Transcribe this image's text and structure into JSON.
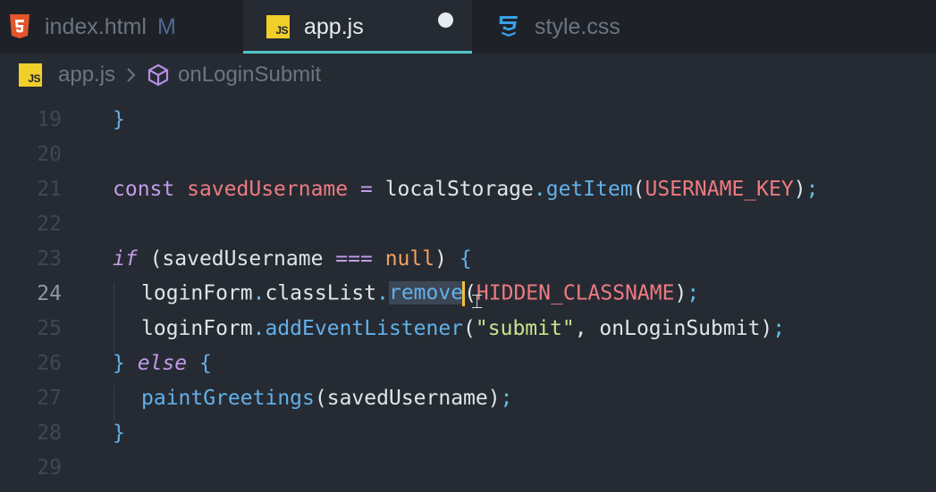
{
  "tabs": [
    {
      "label": "index.html",
      "modifier": "M",
      "icon": "html5-icon",
      "active": false
    },
    {
      "label": "app.js",
      "modifier": "",
      "icon": "js-icon",
      "active": true,
      "unsaved": true
    },
    {
      "label": "style.css",
      "modifier": "",
      "icon": "css3-icon",
      "active": false
    }
  ],
  "js_badge_text": "JS",
  "breadcrumb": {
    "file": "app.js",
    "separator_icon": "chevron-right-icon",
    "symbol_icon": "method-cube-icon",
    "symbol": "onLoginSubmit"
  },
  "editor": {
    "active_line": 24,
    "lines": [
      {
        "num": "19"
      },
      {
        "num": "20"
      },
      {
        "num": "21"
      },
      {
        "num": "22"
      },
      {
        "num": "23"
      },
      {
        "num": "24"
      },
      {
        "num": "25"
      },
      {
        "num": "26"
      },
      {
        "num": "27"
      },
      {
        "num": "28"
      },
      {
        "num": "29"
      }
    ],
    "tokens": {
      "l19_brace": "}",
      "const": "const",
      "savedUsername": "savedUsername",
      "eq": "=",
      "localStorage": "localStorage",
      "getItem": "getItem",
      "USERNAME_KEY": "USERNAME_KEY",
      "if": "if",
      "strict_eq": "===",
      "null": "null",
      "loginForm": "loginForm",
      "classList": "classList",
      "remove": "remove",
      "HIDDEN_CLASSNAME": "HIDDEN_CLASSNAME",
      "addEventListener": "addEventListener",
      "submit": "\"submit\"",
      "onLoginSubmit": "onLoginSubmit",
      "else": "else",
      "paintGreetings": "paintGreetings"
    }
  },
  "colors": {
    "background": "#262b33",
    "tabbar": "#1e2228",
    "active_tab_underline": "#50c4c6",
    "keyword": "#c39be8",
    "variable": "#ef7a80",
    "function": "#62b0ea",
    "string": "#c7e48e",
    "null": "#f3a25e",
    "cursor": "#f3c03c"
  }
}
